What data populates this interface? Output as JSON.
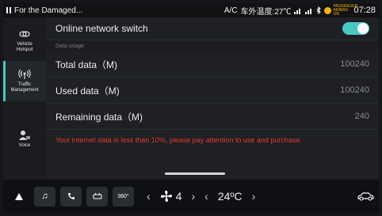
{
  "status_bar": {
    "media_title": "For the Damaged...",
    "ac_label": "A/C",
    "outside_temp": "车外温度:27℃",
    "airbag_text": "PASSENGER AIRBAG ON",
    "time": "07:28"
  },
  "sidebar": {
    "items": [
      {
        "label": "Vehicle Hotspot",
        "icon": "link-icon"
      },
      {
        "label": "Traffic Management",
        "icon": "wireless-icon",
        "active": true
      },
      {
        "label": "Voice",
        "icon": "voice-icon"
      }
    ]
  },
  "main": {
    "switch_label": "Online network switch",
    "switch_on": true,
    "section_title": "Data usage",
    "rows": [
      {
        "label": "Total data（M)",
        "value": "100240"
      },
      {
        "label": "Used data（M)",
        "value": "100240"
      },
      {
        "label": "Remaining data（M)",
        "value": "240"
      }
    ],
    "warning": "Your internet data is less than 10%, please pay attention to use and purchase."
  },
  "dock": {
    "camera_label": "360°",
    "fan_speed": "4",
    "temperature": "24ºC"
  },
  "colors": {
    "accent": "#47c9c4",
    "warning": "#e03a2e"
  }
}
